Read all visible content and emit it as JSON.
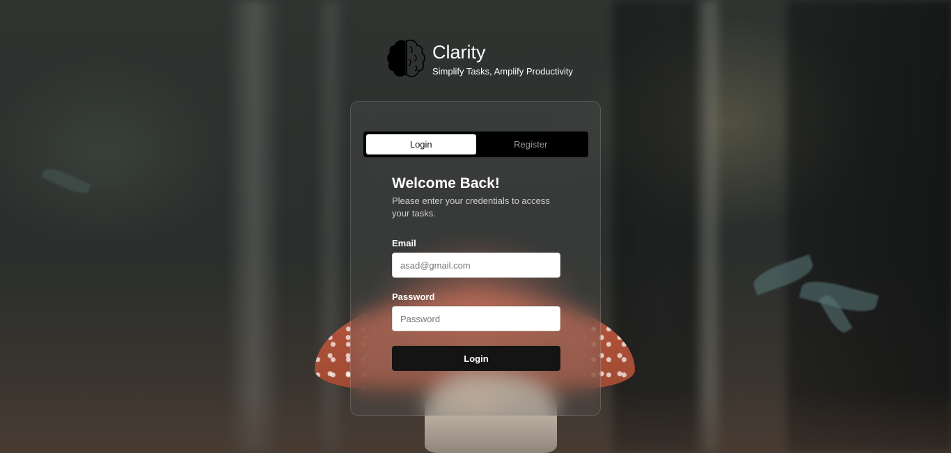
{
  "brand": {
    "title": "Clarity",
    "subtitle": "Simplify Tasks, Amplify Productivity",
    "icon": "brain-icon"
  },
  "tabs": [
    {
      "label": "Login",
      "active": true
    },
    {
      "label": "Register",
      "active": false
    }
  ],
  "form": {
    "heading": "Welcome Back!",
    "subtext": "Please enter your credentials to access your tasks.",
    "email": {
      "label": "Email",
      "placeholder": "asad@gmail.com"
    },
    "password": {
      "label": "Password",
      "placeholder": "Password"
    },
    "submit_label": "Login"
  },
  "colors": {
    "button_bg": "#141414",
    "tab_active_bg": "#ffffff",
    "tab_bar_bg": "#000000"
  }
}
